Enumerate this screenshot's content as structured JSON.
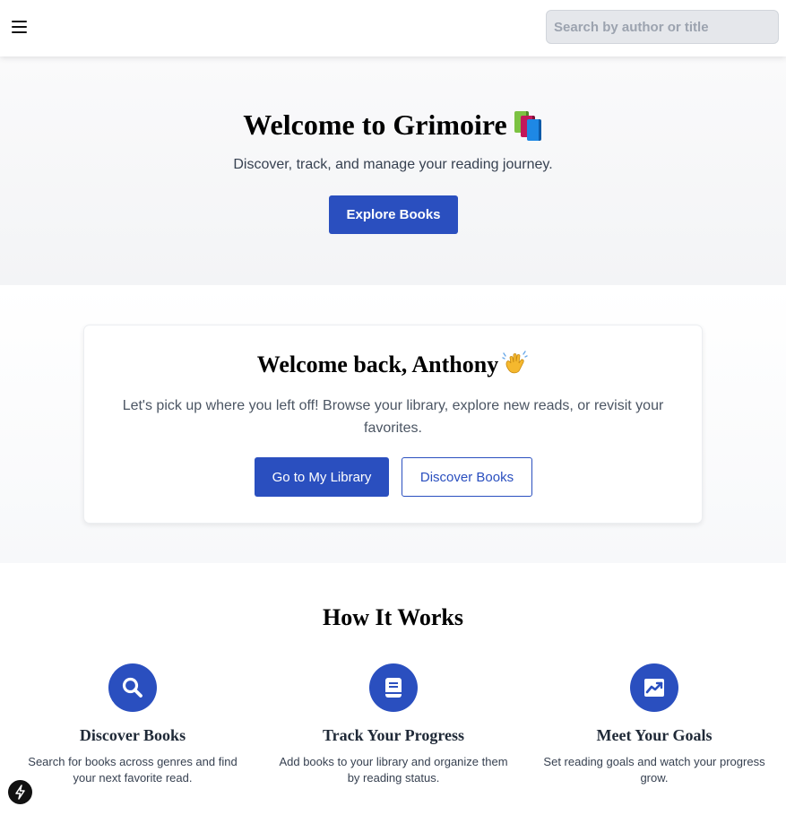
{
  "header": {
    "menu_icon": "hamburger-menu-icon",
    "search": {
      "placeholder": "Search by author or title",
      "value": ""
    }
  },
  "hero": {
    "title": "Welcome to Grimoire",
    "title_emoji": "books-emoji",
    "subtitle": "Discover, track, and manage your reading journey.",
    "cta_label": "Explore Books"
  },
  "welcome": {
    "title": "Welcome back, Anthony",
    "title_emoji": "waving-hand-emoji",
    "text": "Let's pick up where you left off! Browse your library, explore new reads, or revisit your favorites.",
    "primary_label": "Go to My Library",
    "secondary_label": "Discover Books"
  },
  "how_it_works": {
    "title": "How It Works",
    "features": [
      {
        "icon": "search-icon",
        "title": "Discover Books",
        "text": "Search for books across genres and find your next favorite read."
      },
      {
        "icon": "book-icon",
        "title": "Track Your Progress",
        "text": "Add books to your library and organize them by reading status."
      },
      {
        "icon": "trending-up-chart-icon",
        "title": "Meet Your Goals",
        "text": "Set reading goals and watch your progress grow."
      }
    ]
  },
  "dev_badge_icon": "lightning-bolt-icon",
  "colors": {
    "accent": "#2a4fbf",
    "hero_bg": "#f3f4f6",
    "text": "#1f2937"
  }
}
